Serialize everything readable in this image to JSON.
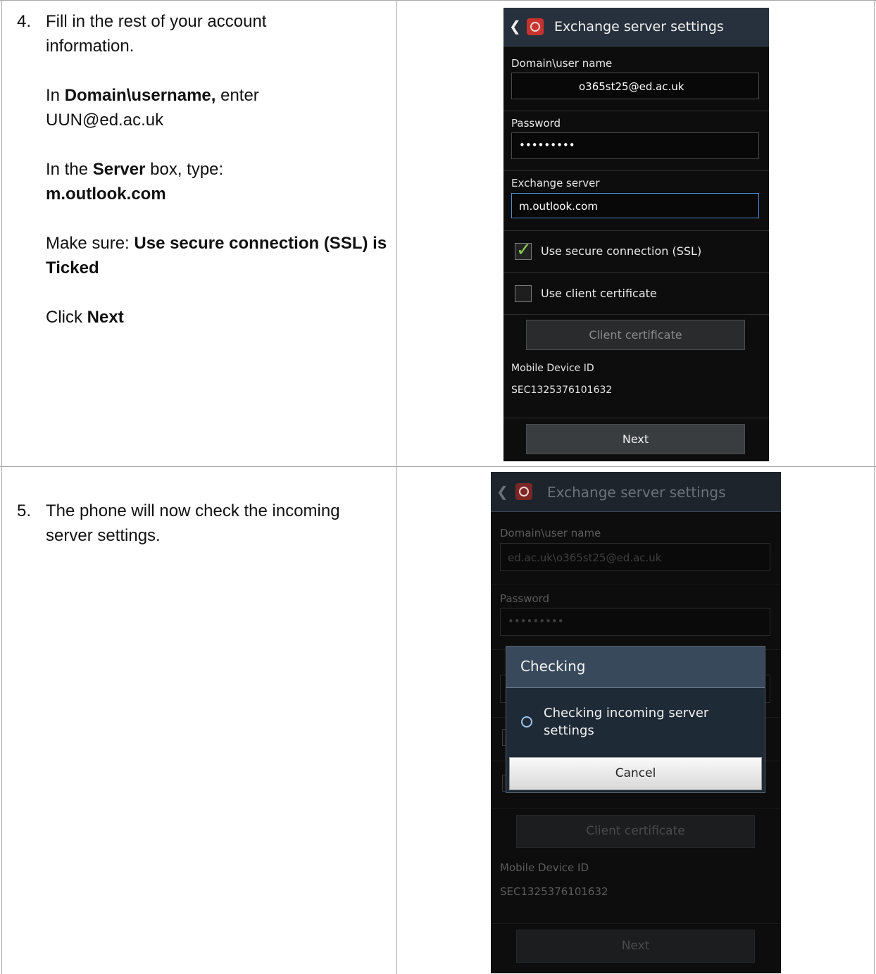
{
  "step4": {
    "number": "4.",
    "intro": "Fill in the rest of your account information.",
    "domain_prefix": "In ",
    "domain_bold": "Domain\\username,",
    "domain_suffix": " enter UUN@ed.ac.uk",
    "server_prefix": "In the ",
    "server_bold": "Server",
    "server_suffix": " box, type:",
    "server_value": "m.outlook.com",
    "ssl_prefix": "Make sure: ",
    "ssl_bold": "Use secure connection (SSL) is Ticked",
    "next_prefix": "Click ",
    "next_bold": "Next"
  },
  "step5": {
    "number": "5.",
    "text": "The phone will now check the incoming server settings."
  },
  "screen1": {
    "title": "Exchange server settings",
    "back_icon": "chevron-left-icon",
    "app_icon": "email-app-icon",
    "domain_label": "Domain\\user name",
    "domain_value": "o365st25@ed.ac.uk",
    "password_label": "Password",
    "password_value": "•••••••••",
    "server_label": "Exchange server",
    "server_value": "m.outlook.com",
    "ssl_label": "Use secure connection (SSL)",
    "ssl_checked": true,
    "client_cert_label": "Use client certificate",
    "client_cert_checked": false,
    "client_cert_button": "Client certificate",
    "device_id_label": "Mobile Device ID",
    "device_id_value": "SEC1325376101632",
    "next_button": "Next"
  },
  "screen2": {
    "title": "Exchange server settings",
    "domain_label": "Domain\\user name",
    "domain_value": "ed.ac.uk\\o365st25@ed.ac.uk",
    "password_label": "Password",
    "password_value": "•••••••••",
    "client_cert_button": "Client certificate",
    "device_id_label": "Mobile Device ID",
    "device_id_value": "SEC1325376101632",
    "next_button": "Next",
    "dialog": {
      "title": "Checking",
      "message": "Checking incoming server settings",
      "cancel": "Cancel"
    }
  }
}
